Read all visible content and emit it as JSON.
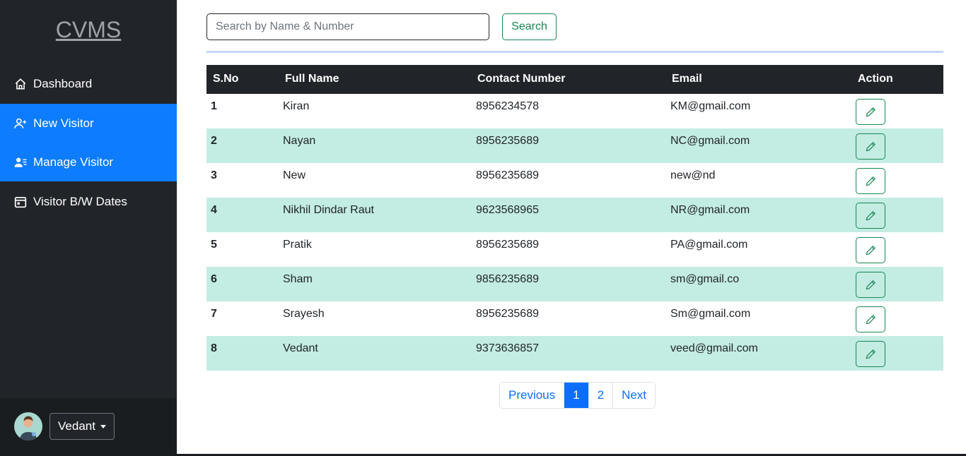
{
  "sidebar": {
    "brand": "CVMS",
    "items": [
      {
        "label": "Dashboard",
        "icon": "home-icon",
        "active": false
      },
      {
        "label": "New Visitor",
        "icon": "user-plus-icon",
        "active": true
      },
      {
        "label": "Manage Visitor",
        "icon": "user-list-icon",
        "active": true
      },
      {
        "label": "Visitor B/W Dates",
        "icon": "calendar-icon",
        "active": false
      }
    ],
    "user": {
      "name": "Vedant"
    }
  },
  "search": {
    "placeholder": "Search by Name & Number",
    "button_label": "Search"
  },
  "table": {
    "headers": [
      "S.No",
      "Full Name",
      "Contact Number",
      "Email",
      "Action"
    ],
    "rows": [
      {
        "sno": "1",
        "name": "Kiran",
        "contact": "8956234578",
        "email": "KM@gmail.com"
      },
      {
        "sno": "2",
        "name": "Nayan",
        "contact": "8956235689",
        "email": "NC@gmail.com"
      },
      {
        "sno": "3",
        "name": "New",
        "contact": "8956235689",
        "email": "new@nd"
      },
      {
        "sno": "4",
        "name": "Nikhil Dindar Raut",
        "contact": "9623568965",
        "email": "NR@gmail.com"
      },
      {
        "sno": "5",
        "name": "Pratik",
        "contact": "8956235689",
        "email": "PA@gmail.com"
      },
      {
        "sno": "6",
        "name": "Sham",
        "contact": "9856235689",
        "email": "sm@gmail.co"
      },
      {
        "sno": "7",
        "name": "Srayesh",
        "contact": "8956235689",
        "email": "Sm@gmail.com"
      },
      {
        "sno": "8",
        "name": "Vedant",
        "contact": "9373636857",
        "email": "veed@gmail.com"
      }
    ]
  },
  "pagination": {
    "previous": "Previous",
    "pages": [
      "1",
      "2"
    ],
    "current": "1",
    "next": "Next"
  },
  "colors": {
    "sidebar": "#212529",
    "active": "#0d7cff",
    "striped": "#c3ece3",
    "success": "#198754",
    "primary": "#0d6efd"
  }
}
